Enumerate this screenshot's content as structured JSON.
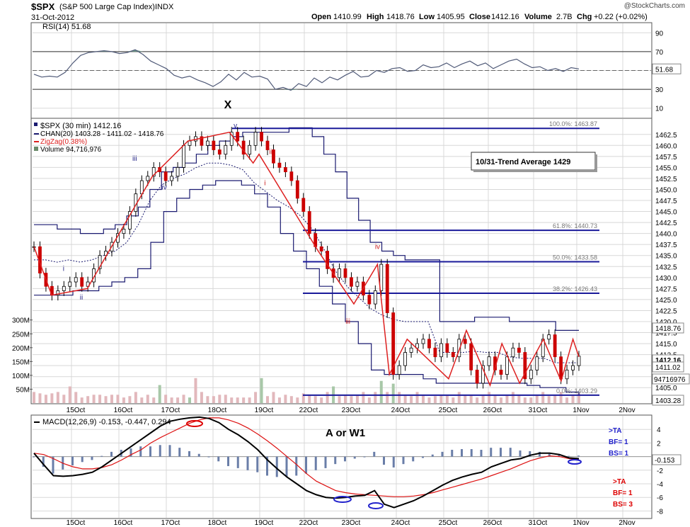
{
  "header": {
    "symbol": "$SPX",
    "name": "(S&P 500 Large Cap Index)",
    "exchange": "INDX",
    "date": "31-Oct-2012",
    "watermark": "@StockCharts.com",
    "quote": {
      "open_label": "Open",
      "open": "1410.99",
      "high_label": "High",
      "high": "1418.76",
      "low_label": "Low",
      "low": "1405.95",
      "close_label": "Close",
      "close": "1412.16",
      "volume_label": "Volume",
      "volume": "2.7B",
      "chg_label": "Chg",
      "chg": "+0.22 (+0.02%)"
    }
  },
  "colors": {
    "grid": "#d8d8d8",
    "price_candle": "#cc0000",
    "zigzag": "#dd2020",
    "channel": "#1a1a70",
    "fib": "#1a1a9a",
    "rsi_line": "#505a78",
    "rsi_fill": "#6e9c8c",
    "volume": "#e2b8bc",
    "volume_up": "#a8c8a8",
    "macd_line": "#000000",
    "signal_line": "#dd1111",
    "histogram": "#6a7ea8",
    "marker_red": "#dd0000",
    "marker_blue": "#2222cc"
  },
  "chart_data": {
    "type": "line",
    "x_tick_labels": [
      "15Oct",
      "16Oct",
      "17Oct",
      "18Oct",
      "19Oct",
      "22Oct",
      "23Oct",
      "24Oct",
      "25Oct",
      "26Oct",
      "31Oct",
      "1Nov",
      "2Nov"
    ],
    "rsi": {
      "legend": "RSI(14) 51.68",
      "value_tag": "51.68",
      "yticks": [
        "90",
        "70",
        "50",
        "30",
        "10"
      ],
      "levels": [
        70,
        30
      ],
      "ylim": [
        0,
        100
      ],
      "values": [
        46,
        43,
        44,
        43,
        48,
        58,
        66,
        69,
        70,
        71,
        70,
        68,
        69,
        72,
        67,
        60,
        56,
        52,
        45,
        42,
        44,
        40,
        37,
        33,
        38,
        46,
        40,
        48,
        43,
        44,
        41,
        30,
        32,
        29,
        36,
        33,
        42,
        37,
        43,
        40,
        45,
        49,
        43,
        44,
        50,
        48,
        52,
        53,
        49,
        50,
        56,
        53,
        54,
        58,
        53,
        57,
        60,
        55,
        58,
        52,
        56,
        60,
        62,
        57,
        53,
        54,
        50,
        52,
        49,
        53,
        51.68
      ]
    },
    "price": {
      "title": "$SPX (30 min) 1412.16",
      "legend": [
        {
          "label": "$SPX (30 min) 1412.16",
          "color": "#000000"
        },
        {
          "label": "CHAN(20) 1403.28 - 1411.02 - 1418.76",
          "color": "#1a1a70"
        },
        {
          "label": "ZigZag(0.38%)",
          "color": "#dd2020"
        },
        {
          "label": "Volume 94,716,976",
          "color": "#6a8a6a"
        }
      ],
      "yticks": [
        1405,
        1407.5,
        1410,
        1412.5,
        1415,
        1417.5,
        1420,
        1422.5,
        1425,
        1427.5,
        1430,
        1432.5,
        1435,
        1437.5,
        1440,
        1442.5,
        1445,
        1447.5,
        1450,
        1452.5,
        1455,
        1457.5,
        1460,
        1462.5
      ],
      "ytick_labels": [
        "1405.0",
        "1407.5",
        "1410.0",
        "1412.5",
        "1415.0",
        "1417.5",
        "1420.0",
        "1422.5",
        "1425.0",
        "1427.5",
        "1430.0",
        "1432.5",
        "1435.0",
        "1437.5",
        "1440.0",
        "1442.5",
        "1445.0",
        "1447.5",
        "1450.0",
        "1452.5",
        "1455.0",
        "1457.5",
        "1460.0",
        "1462.5"
      ],
      "ylim": [
        1401.5,
        1466
      ],
      "close": [
        1437,
        1431,
        1428,
        1426,
        1427,
        1428,
        1429,
        1430,
        1428,
        1429,
        1432,
        1435,
        1436,
        1438,
        1440,
        1441,
        1445,
        1449,
        1452,
        1453,
        1455,
        1454,
        1452,
        1453,
        1455,
        1460,
        1461,
        1462,
        1460,
        1461,
        1459,
        1458,
        1460,
        1463,
        1461,
        1458,
        1460,
        1463,
        1461,
        1459,
        1456,
        1455,
        1454,
        1452,
        1448,
        1445,
        1440,
        1437,
        1436,
        1432,
        1430,
        1432,
        1430,
        1428,
        1429,
        1426,
        1424,
        1427,
        1433,
        1422,
        1408,
        1410,
        1413,
        1414,
        1415,
        1416,
        1414,
        1412,
        1415,
        1413,
        1412,
        1416,
        1415,
        1409,
        1406,
        1410,
        1412,
        1409,
        1408,
        1412,
        1414,
        1413,
        1407,
        1409,
        1412,
        1416,
        1417,
        1412,
        1407,
        1409,
        1410,
        1412.16
      ],
      "zigzag": [
        [
          0,
          1437
        ],
        [
          3,
          1426
        ],
        [
          9,
          1427.5
        ],
        [
          20,
          1453
        ],
        [
          26,
          1461
        ],
        [
          33,
          1463
        ],
        [
          37,
          1456
        ],
        [
          38,
          1458
        ],
        [
          48,
          1436
        ],
        [
          49,
          1434
        ],
        [
          54,
          1424
        ],
        [
          58,
          1433
        ],
        [
          60,
          1408
        ],
        [
          63,
          1416
        ],
        [
          70,
          1407
        ],
        [
          73,
          1418
        ],
        [
          77,
          1405.5
        ],
        [
          79,
          1415
        ],
        [
          82,
          1406
        ],
        [
          86,
          1416
        ],
        [
          89,
          1406.5
        ],
        [
          91,
          1416
        ],
        [
          92,
          1412
        ]
      ],
      "zigzag_x_range": [
        0,
        92
      ],
      "channel_upper": [
        1442,
        1442,
        1441,
        1441,
        1440,
        1440,
        1441,
        1442,
        1444,
        1446,
        1450,
        1454,
        1455,
        1456,
        1458,
        1460,
        1461,
        1462,
        1463,
        1463,
        1463,
        1463,
        1464,
        1464,
        1462,
        1458,
        1454,
        1448,
        1443,
        1438,
        1436,
        1435,
        1434,
        1434,
        1434,
        1420,
        1420,
        1420,
        1421,
        1421,
        1421,
        1420,
        1420,
        1420,
        1420,
        1418,
        1418,
        1418
      ],
      "channel_lower": [
        1426,
        1426,
        1426,
        1427,
        1427,
        1428,
        1429,
        1430,
        1432,
        1438,
        1445,
        1448,
        1450,
        1451,
        1452,
        1452,
        1451,
        1449,
        1446,
        1440,
        1436,
        1432,
        1428,
        1424,
        1420,
        1415,
        1409,
        1408,
        1408,
        1408,
        1407,
        1406,
        1406,
        1406,
        1406,
        1406,
        1406,
        1406,
        1405.5,
        1405,
        1405,
        1404,
        1403.3
      ],
      "fib_levels": [
        {
          "pct_label": "100.0%: 1463.87",
          "value": 1463.87
        },
        {
          "pct_label": "61.8%: 1440.73",
          "value": 1440.73
        },
        {
          "pct_label": "50.0%: 1433.58",
          "value": 1433.58
        },
        {
          "pct_label": "38.2%: 1426.43",
          "value": 1426.43
        },
        {
          "pct_label": "0.0%: 1403.29",
          "value": 1403.29
        }
      ],
      "value_tags": [
        {
          "text": "1418.76",
          "value": 1418.76,
          "style": "plain"
        },
        {
          "text": "1412.16",
          "value": 1412.16,
          "style": "bold"
        },
        {
          "text": "1411.02",
          "value": 1411.02,
          "style": "plain"
        },
        {
          "text": "1403.28",
          "value": 1403.28,
          "style": "plain"
        }
      ],
      "wave_labels": [
        {
          "text": "iii",
          "x": 17,
          "y": 1456.5
        },
        {
          "text": "iv",
          "x": 22,
          "y": 1450
        },
        {
          "text": "ii",
          "x": 8,
          "y": 1425
        },
        {
          "text": "i",
          "x": 5,
          "y": 1431.5
        },
        {
          "text": "v",
          "x": 34,
          "y": 1464
        },
        {
          "text": "ii",
          "x": 40,
          "y": 1458
        },
        {
          "text": "i",
          "x": 39,
          "y": 1451
        },
        {
          "text": "iv",
          "x": 58,
          "y": 1436.5
        },
        {
          "text": "iii",
          "x": 53,
          "y": 1419.5
        }
      ],
      "main_label": {
        "text": "X",
        "x": 34,
        "y": 1466
      }
    },
    "volume": {
      "legend": "Volume 94,716,976",
      "value_tag": "94716976",
      "yticks": [
        "300M",
        "250M",
        "200M",
        "150M",
        "100M",
        "50M"
      ],
      "ytick_values": [
        300,
        250,
        200,
        150,
        100,
        50
      ],
      "ylim": [
        0,
        330
      ],
      "values": [
        40,
        35,
        30,
        35,
        40,
        30,
        60,
        40,
        20,
        25,
        30,
        30,
        25,
        30,
        30,
        20,
        25,
        40,
        20,
        30,
        20,
        65,
        30,
        20,
        20,
        30,
        20,
        90,
        40,
        25,
        25,
        30,
        30,
        20,
        20,
        20,
        20,
        40,
        90,
        25,
        40,
        20,
        30,
        25,
        20,
        35,
        30,
        25,
        20,
        40,
        60,
        25,
        30,
        25,
        30,
        40,
        20,
        40,
        80,
        40,
        70,
        40,
        30,
        25,
        40,
        30,
        20,
        25,
        30,
        30,
        20,
        40,
        30,
        30,
        20,
        30,
        40,
        30,
        20,
        30,
        40,
        30,
        20,
        20,
        30,
        40,
        25,
        30,
        40,
        20,
        30,
        35
      ],
      "volume_up_bars": [
        21,
        26,
        38,
        50,
        58,
        60
      ]
    },
    "macd": {
      "legend": "MACD(12,26,9) -0.153, -0.447, 0.294",
      "value_tag": "-0.153",
      "yticks": [
        "4",
        "2",
        "0",
        "-2",
        "-4",
        "-6",
        "-8"
      ],
      "ytick_values": [
        4,
        2,
        0,
        -2,
        -4,
        -6,
        -8
      ],
      "ylim": [
        -9,
        6
      ],
      "macd": [
        0.5,
        -1.2,
        -2.8,
        -2.9,
        -2.8,
        -2.6,
        -2.3,
        -1.5,
        -0.5,
        0.5,
        1.5,
        2.5,
        3.5,
        4.5,
        5.2,
        5.5,
        5.7,
        5.8,
        5.6,
        5.0,
        4.0,
        3.2,
        2.2,
        1.0,
        -0.5,
        -1.8,
        -3.0,
        -4.0,
        -5.0,
        -5.6,
        -6.0,
        -6.1,
        -6.0,
        -5.8,
        -5.7,
        -5.0,
        -7.0,
        -7.5,
        -7.0,
        -6.5,
        -5.8,
        -5.0,
        -4.2,
        -3.5,
        -3.0,
        -2.6,
        -2.3,
        -1.5,
        -1.0,
        -0.5,
        -0.3,
        0.2,
        0.5,
        0.5,
        0.3,
        -0.2,
        -0.3
      ],
      "signal": [
        0.5,
        0.3,
        -0.3,
        -1.0,
        -1.5,
        -1.8,
        -1.8,
        -1.6,
        -1.2,
        -0.5,
        0.3,
        1.0,
        2.0,
        2.8,
        3.5,
        4.2,
        4.9,
        5.4,
        5.7,
        5.7,
        5.4,
        4.9,
        4.2,
        3.3,
        2.3,
        1.2,
        0.0,
        -1.2,
        -2.5,
        -3.6,
        -4.3,
        -5.0,
        -5.3,
        -5.5,
        -5.6,
        -5.7,
        -5.8,
        -5.9,
        -5.9,
        -5.8,
        -5.6,
        -5.3,
        -4.9,
        -4.5,
        -4.1,
        -3.7,
        -3.3,
        -2.8,
        -2.3,
        -1.8,
        -1.2,
        -0.6,
        -0.2,
        0.1,
        0.0,
        -0.3,
        -0.447
      ],
      "main_label": "A or W1",
      "notes_blue": [
        "> TA",
        "BF= 1",
        "BS= 1"
      ],
      "notes_red": [
        ">TA",
        "BF= 1",
        "BS= 3"
      ],
      "notes_blue_text": [
        ">TA",
        "BF= 1",
        "BS= 1"
      ],
      "notes_red_text": [
        ">TA",
        "BF= 1",
        "BS= 3"
      ]
    },
    "annotation_box": "10/31-Trend Average 1429"
  }
}
